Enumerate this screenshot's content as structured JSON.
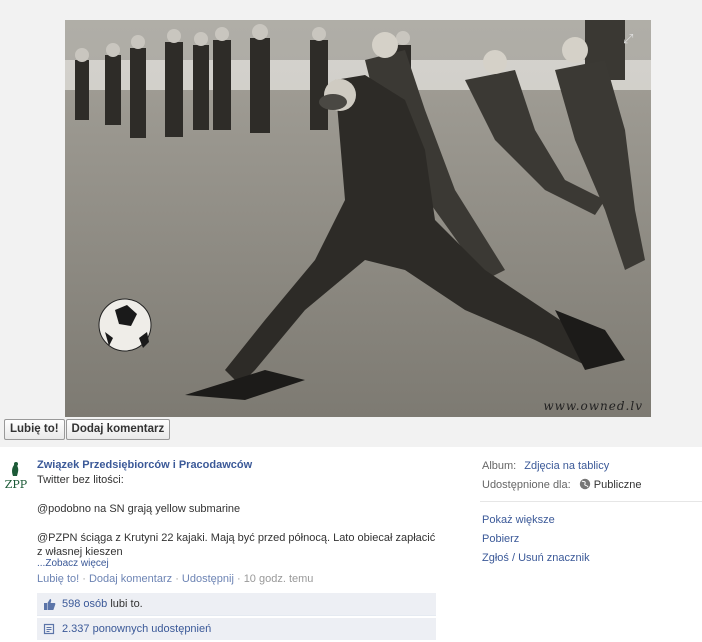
{
  "photo": {
    "expand_icon": "expand-icon",
    "watermark": "www.owned.lv"
  },
  "actions": {
    "like_label": "Lubię to!",
    "comment_label": "Dodaj komentarz"
  },
  "post": {
    "owner": "Związek Przedsiębiorców i Pracodawców",
    "logo_text": "ZPP",
    "lines": [
      "Twitter bez litości:",
      "@podobno na SN grają yellow submarine",
      "@PZPN ściąga z Krutyni 22 kajaki. Mają być przed północą. Lato obiecał zapłacić z własnej kieszen"
    ],
    "see_more": "...Zobacz więcej",
    "meta": {
      "like": "Lubię to!",
      "comment": "Dodaj komentarz",
      "share": "Udostępnij",
      "time": "10 godz. temu",
      "separator": " · "
    },
    "likes": {
      "count_link": "598 osób",
      "suffix": "lubi to."
    },
    "shares": {
      "text": "2.337 ponownych udostępnień"
    }
  },
  "sidebar": {
    "album_label": "Album:",
    "album_value": "Zdjęcia na tablicy",
    "shared_label": "Udostępnione dla:",
    "shared_value": "Publiczne",
    "links": [
      "Pokaż większe",
      "Pobierz",
      "Zgłoś / Usuń znacznik"
    ]
  },
  "colors": {
    "link": "#3b5998",
    "stage_bg": "#f2f2f2",
    "box_bg": "#edeff4"
  }
}
